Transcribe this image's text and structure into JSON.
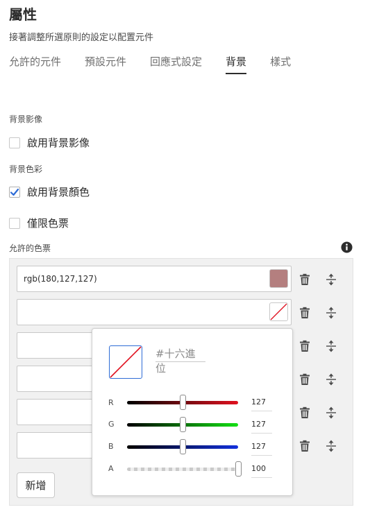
{
  "header": {
    "title": "屬性",
    "subtitle": "接著調整所選原則的設定以配置元件"
  },
  "tabs": [
    {
      "label": "允許的元件",
      "active": false
    },
    {
      "label": "預設元件",
      "active": false
    },
    {
      "label": "回應式設定",
      "active": false
    },
    {
      "label": "背景",
      "active": true
    },
    {
      "label": "樣式",
      "active": false
    }
  ],
  "background_image": {
    "section_label": "背景影像",
    "enable_label": "啟用背景影像",
    "enable_checked": false
  },
  "background_color": {
    "section_label": "背景色彩",
    "enable_label": "啟用背景顏色",
    "enable_checked": true,
    "swatches_only_label": "僅限色票",
    "swatches_only_checked": false
  },
  "allowed_swatches": {
    "label": "允許的色票",
    "rows": [
      {
        "value": "rgb(180,127,127)",
        "color": "#b47f7f"
      },
      {
        "value": "",
        "color": ""
      },
      {
        "value": "",
        "color": ""
      },
      {
        "value": "",
        "color": ""
      },
      {
        "value": "",
        "color": ""
      },
      {
        "value": "",
        "color": ""
      }
    ],
    "add_label": "新增"
  },
  "color_picker": {
    "hex_placeholder": "#十六進位",
    "channels": [
      {
        "label": "R",
        "value": "127",
        "level": 0.5
      },
      {
        "label": "G",
        "value": "127",
        "level": 0.5
      },
      {
        "label": "B",
        "value": "127",
        "level": 0.5
      },
      {
        "label": "A",
        "value": "100",
        "level": 1.0
      }
    ]
  },
  "colors": {
    "accent": "#2d6bd6",
    "no_color_stroke": "#e0111f"
  },
  "icons": [
    "check-icon",
    "info-icon",
    "trash-icon",
    "move-icon"
  ]
}
